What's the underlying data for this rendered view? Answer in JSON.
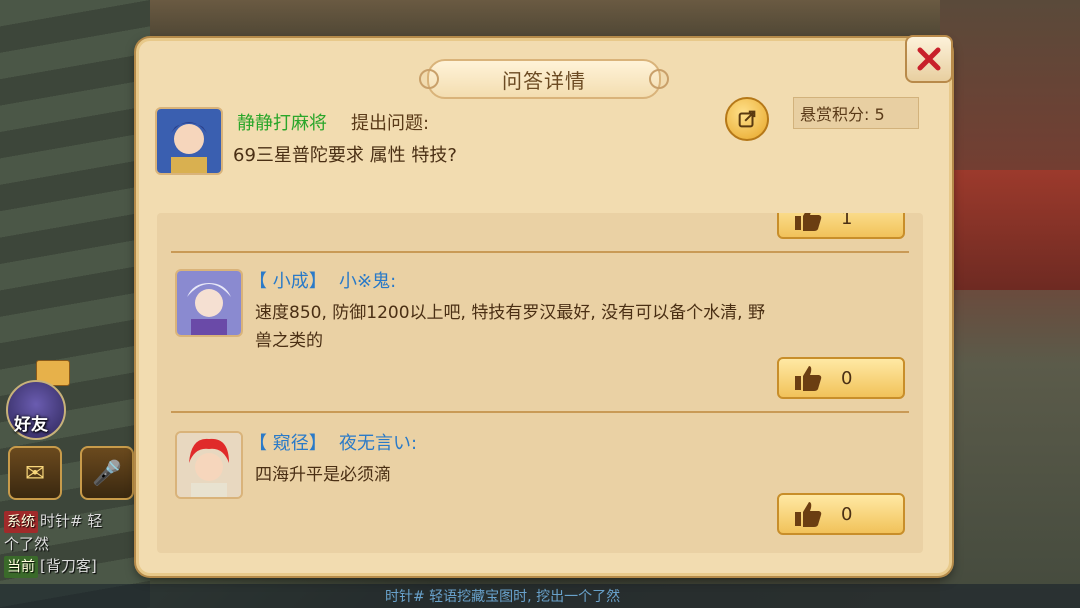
{
  "dialog": {
    "title": "问答详情",
    "question": {
      "asker_name": "静静打麻将",
      "asker_suffix": "提出问题:",
      "text": "69三星普陀要求 属性 特技?",
      "reward": "悬赏积分: 5"
    },
    "answers": [
      {
        "school": "【 小成】",
        "name": "小※鬼:",
        "text_line1": "速度850, 防御1200以上吧, 特技有罗汉最好, 没有可以备个水清, 野",
        "text_line2": "兽之类的",
        "likes": "0"
      },
      {
        "school": "【 窥径】",
        "name": "夜无言い:",
        "text_line1": "四海升平是必须滴",
        "likes": "0"
      }
    ],
    "partial_like_count": "1"
  },
  "hud": {
    "friend_label": "好友",
    "chat_lines": [
      {
        "tag": "系统",
        "text": "时针# 轻"
      },
      {
        "tag": "",
        "text": "个了然"
      },
      {
        "tag": "当前",
        "text": "[背刀客]"
      }
    ],
    "bottom_chat": "时针# 轻语挖藏宝图时, 挖出一个了然"
  },
  "colors": {
    "panel": "#f2dcb0",
    "asker_name": "#2aa62a",
    "answer_name": "#2a7ac8",
    "close_x": "#c8202a"
  }
}
